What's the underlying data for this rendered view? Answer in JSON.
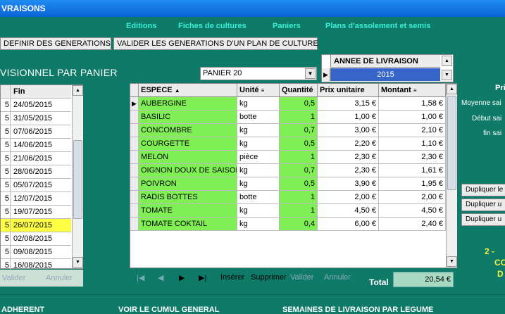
{
  "window_title": "VRAISONS",
  "menu": [
    "Editions",
    "Fiches de cultures",
    "Paniers",
    "Plans d'assolement et semis"
  ],
  "buttons": {
    "definir": "DEFINIR DES GENERATIONS",
    "valider": "VALIDER LES GENERATIONS D'UN PLAN DE CULTURE"
  },
  "section_title": "VISIONNEL PAR PANIER",
  "panier_combo": "PANIER 20",
  "year": {
    "label": "ANNEE DE LIVRAISON",
    "value": "2015"
  },
  "left_grid": {
    "col_left": "",
    "col_fin": "Fin",
    "rows": [
      {
        "c": "5",
        "fin": "24/05/2015"
      },
      {
        "c": "5",
        "fin": "31/05/2015"
      },
      {
        "c": "5",
        "fin": "07/06/2015"
      },
      {
        "c": "5",
        "fin": "14/06/2015"
      },
      {
        "c": "5",
        "fin": "21/06/2015"
      },
      {
        "c": "5",
        "fin": "28/06/2015"
      },
      {
        "c": "5",
        "fin": "05/07/2015"
      },
      {
        "c": "5",
        "fin": "12/07/2015"
      },
      {
        "c": "5",
        "fin": "19/07/2015"
      },
      {
        "c": "5",
        "fin": "26/07/2015"
      },
      {
        "c": "5",
        "fin": "02/08/2015"
      },
      {
        "c": "5",
        "fin": "09/08/2015"
      },
      {
        "c": "5",
        "fin": "16/08/2015"
      }
    ],
    "highlight_row": 9,
    "highlight_color": "#ffff44",
    "tool_valider": "Valider",
    "tool_annuler": "Annuler"
  },
  "grid": {
    "headers": {
      "espece": "ESPECE",
      "unite": "Unité",
      "quantite": "Quantité",
      "prix": "Prix unitaire",
      "montant": "Montant"
    },
    "rows": [
      {
        "espece": "AUBERGINE",
        "unite": "kg",
        "quantite": "0,5",
        "prix": "3,15 €",
        "montant": "1,58 €"
      },
      {
        "espece": "BASILIC",
        "unite": "botte",
        "quantite": "1",
        "prix": "1,00 €",
        "montant": "1,00 €"
      },
      {
        "espece": "CONCOMBRE",
        "unite": "kg",
        "quantite": "0,7",
        "prix": "3,00 €",
        "montant": "2,10 €"
      },
      {
        "espece": "COURGETTE",
        "unite": "kg",
        "quantite": "0,5",
        "prix": "2,20 €",
        "montant": "1,10 €"
      },
      {
        "espece": "MELON",
        "unite": "pièce",
        "quantite": "1",
        "prix": "2,30 €",
        "montant": "2,30 €"
      },
      {
        "espece": "OIGNON DOUX DE SAISON",
        "unite": "kg",
        "quantite": "0,7",
        "prix": "2,30 €",
        "montant": "1,61 €"
      },
      {
        "espece": "POIVRON",
        "unite": "kg",
        "quantite": "0,5",
        "prix": "3,90 €",
        "montant": "1,95 €"
      },
      {
        "espece": "RADIS BOTTES",
        "unite": "botte",
        "quantite": "1",
        "prix": "2,00 €",
        "montant": "2,00 €"
      },
      {
        "espece": "TOMATE",
        "unite": "kg",
        "quantite": "1",
        "prix": "4,50 €",
        "montant": "4,50 €"
      },
      {
        "espece": "TOMATE COKTAIL",
        "unite": "kg",
        "quantite": "0,4",
        "prix": "6,00 €",
        "montant": "2,40 €"
      }
    ]
  },
  "nav": {
    "first": "|◀",
    "prev": "◀",
    "next": "▶",
    "last": "▶|",
    "inserer": "Insérer",
    "supprimer": "Supprimer",
    "valider": "Valider",
    "annuler": "Annuler"
  },
  "total": {
    "label": "Total",
    "value": "20,54 €"
  },
  "right_panel": {
    "pri": "Pri",
    "moyenne": "Moyenne sai",
    "debut": "Début sai",
    "fin": "fin sai",
    "dup1": "Dupliquer le",
    "dup2": "Dupliquer u",
    "dup3": "Dupliquer u",
    "y1": "2 -",
    "y2": "CO",
    "y3": "D"
  },
  "bottom": {
    "a": "ADHERENT",
    "b": "VOIR LE CUMUL GENERAL",
    "c": "SEMAINES DE LIVRAISON PAR LEGUME"
  },
  "colors": {
    "background": "#0f7a68",
    "menu_text": "#39f0d8",
    "cell_green": "#80ee55",
    "year_blue": "#3565c8"
  }
}
